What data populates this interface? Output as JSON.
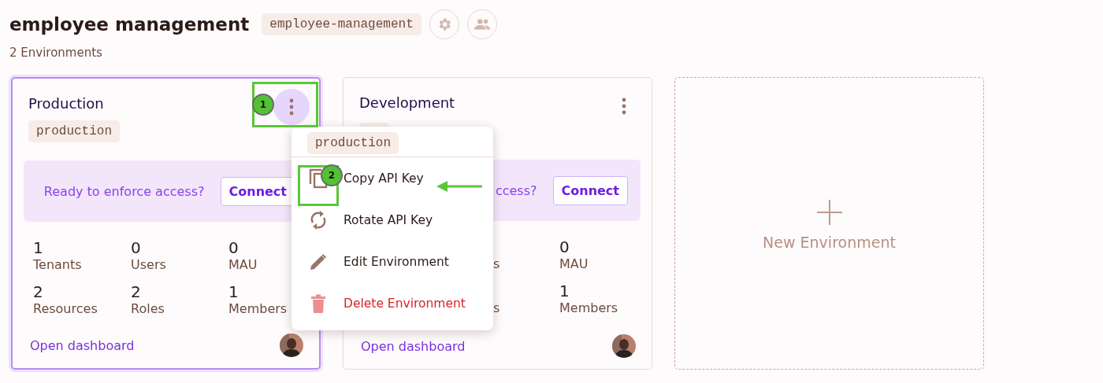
{
  "project": {
    "title": "employee management",
    "slug": "employee-management",
    "count": "2 Environments"
  },
  "environments": [
    {
      "name": "Production",
      "selected": true,
      "slug": "production",
      "banner_text": "Ready to enforce access?",
      "connect": "Connect",
      "stats": [
        {
          "value": "1",
          "label": "Tenants"
        },
        {
          "value": "0",
          "label": "Users"
        },
        {
          "value": "0",
          "label": "MAU"
        },
        {
          "value": "2",
          "label": "Resources"
        },
        {
          "value": "2",
          "label": "Roles"
        },
        {
          "value": "1",
          "label": "Members"
        }
      ],
      "link": "Open dashboard",
      "menu_open": true
    },
    {
      "name": "Development",
      "selected": false,
      "slug_hidden": true,
      "banner_text": "ccess?",
      "connect": "Connect",
      "stats": [
        {
          "label": "s",
          "partial": true
        },
        {
          "value": "0",
          "label": "MAU"
        },
        {
          "label": "s",
          "partial": true
        },
        {
          "value": "1",
          "label": "Members"
        }
      ],
      "link": "Open dashboard",
      "menu_open": false
    }
  ],
  "new_environment": "New Environment",
  "menu": {
    "tag": "production",
    "items": [
      {
        "kind": "copy",
        "label": "Copy API Key"
      },
      {
        "kind": "rotate",
        "label": "Rotate API Key"
      },
      {
        "kind": "edit",
        "label": "Edit Environment"
      },
      {
        "kind": "delete",
        "label": "Delete Environment"
      }
    ]
  },
  "annotations": [
    {
      "number": "1"
    },
    {
      "number": "2"
    }
  ]
}
